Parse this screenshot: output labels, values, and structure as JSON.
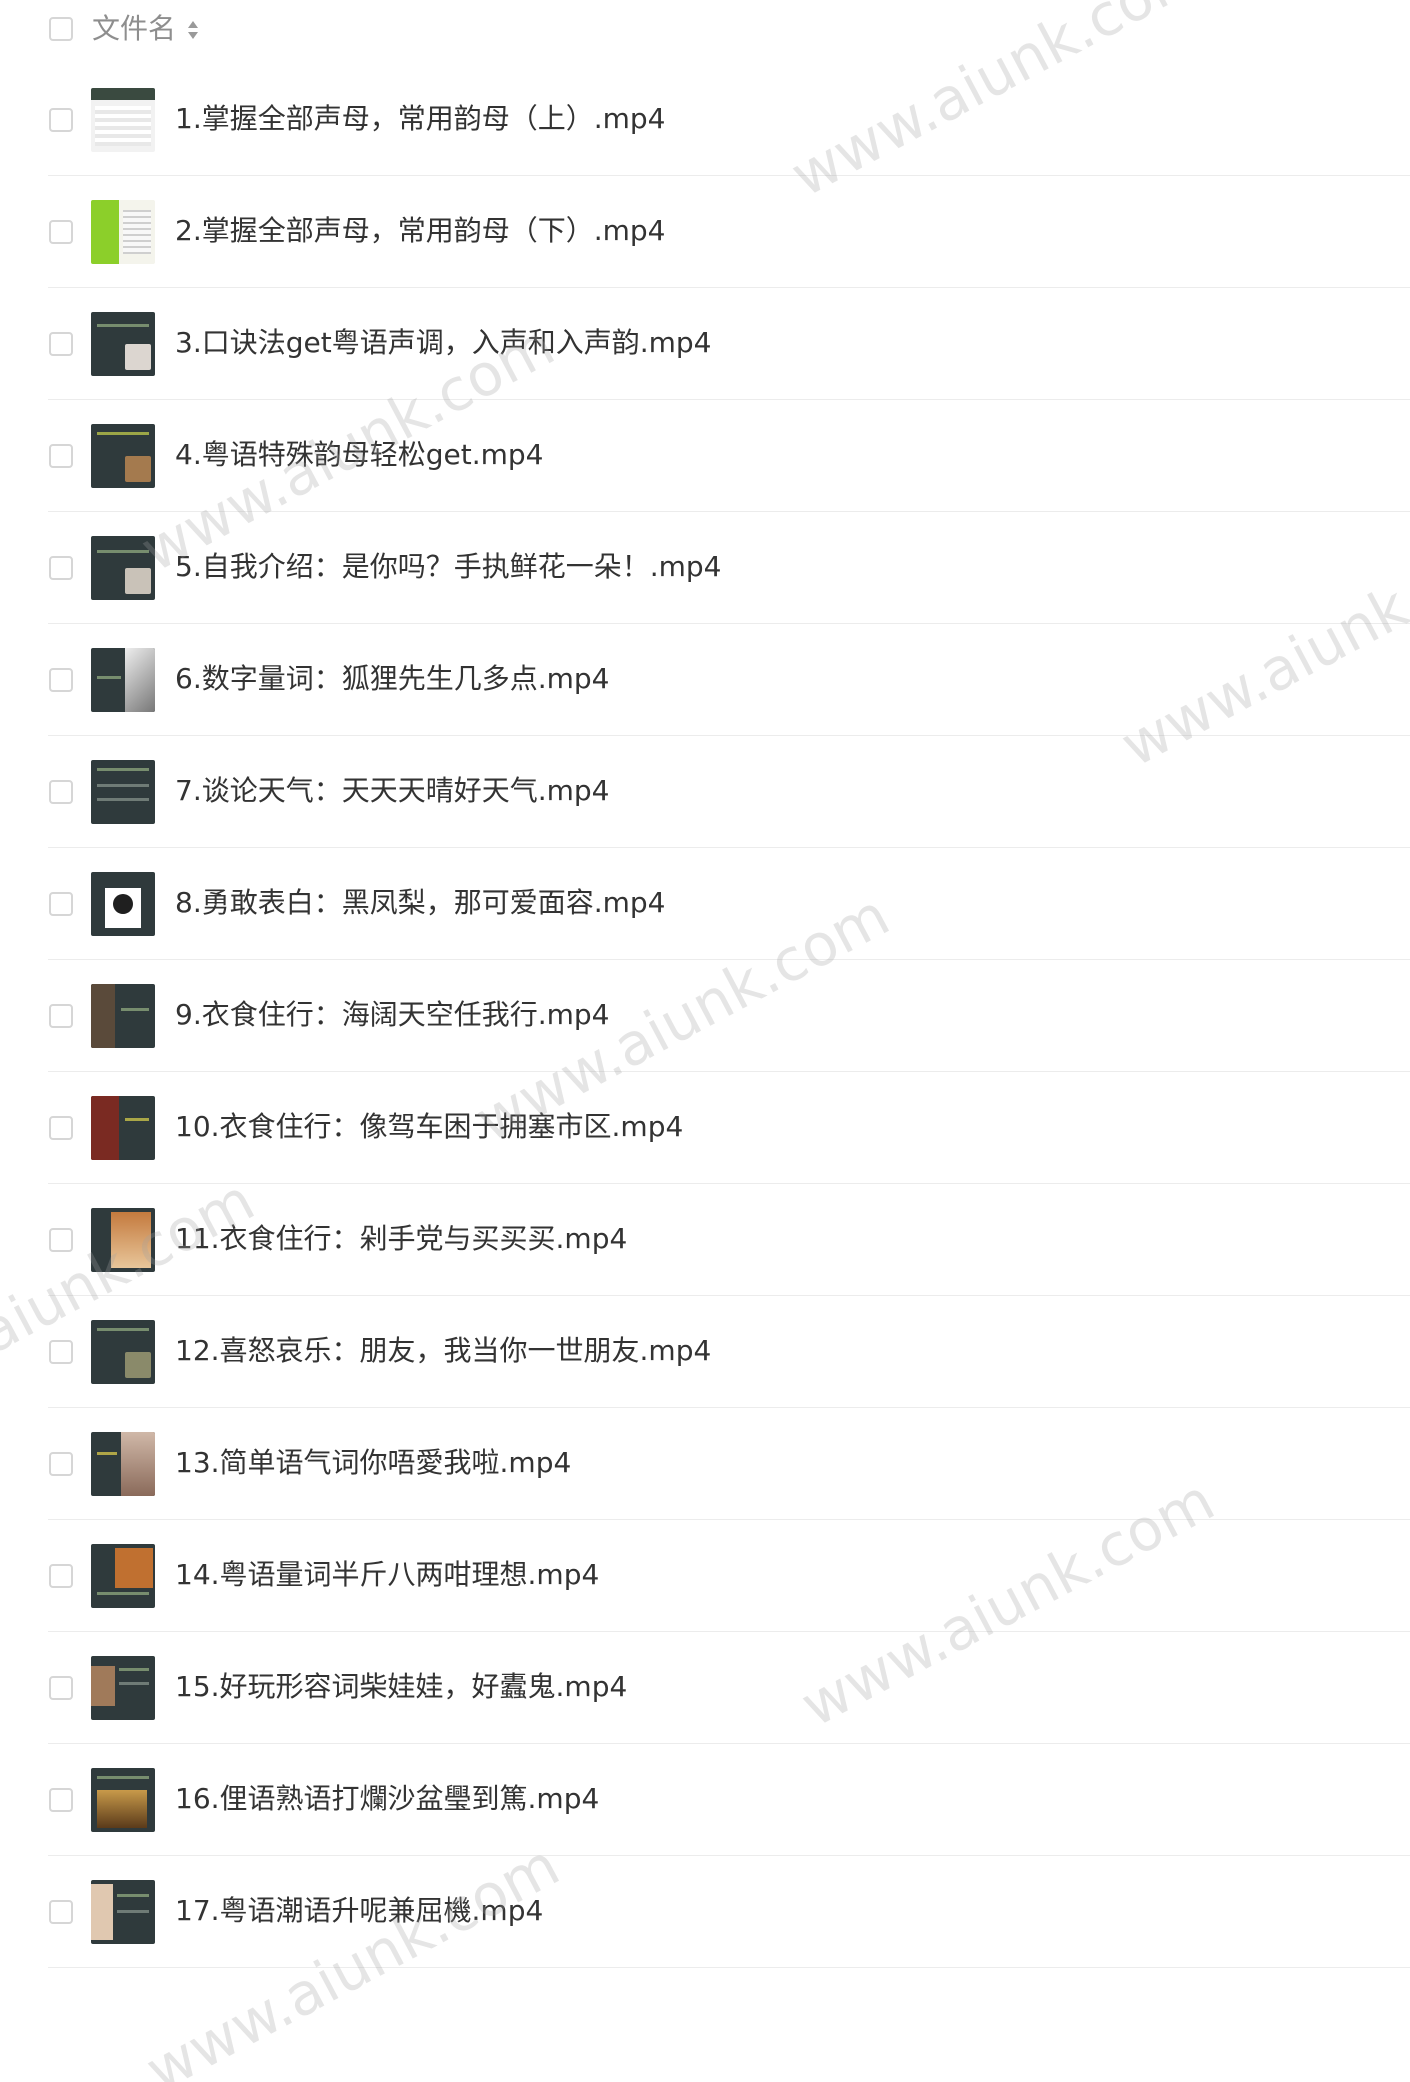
{
  "header": {
    "column_label": "文件名"
  },
  "icons": {
    "sort": "sort-icon",
    "checkbox": "checkbox-icon",
    "thumbnail": "video-thumbnail-icon"
  },
  "colors": {
    "text": "#333333",
    "header_text": "#8e8e8e",
    "divider": "#ececec",
    "checkbox_border": "#d6d6d6",
    "thumb_bg": "#2f3a3c",
    "watermark": "#a0a0a0"
  },
  "watermark_text": "www.aiunk.com",
  "files": [
    {
      "name": "1.掌握全部声母，常用韵母（上）.mp4"
    },
    {
      "name": "2.掌握全部声母，常用韵母（下）.mp4"
    },
    {
      "name": "3.口诀法get粤语声调，入声和入声韵.mp4"
    },
    {
      "name": "4.粤语特殊韵母轻松get.mp4"
    },
    {
      "name": "5.自我介绍：是你吗？手执鲜花一朵！.mp4"
    },
    {
      "name": "6.数字量词：狐狸先生几多点.mp4"
    },
    {
      "name": "7.谈论天气：天天天晴好天气.mp4"
    },
    {
      "name": "8.勇敢表白：黑凤梨，那可爱面容.mp4"
    },
    {
      "name": "9.衣食住行：海阔天空任我行.mp4"
    },
    {
      "name": "10.衣食住行：像驾车困于拥塞市区.mp4"
    },
    {
      "name": "11.衣食住行：剁手党与买买买.mp4"
    },
    {
      "name": "12.喜怒哀乐：朋友，我当你一世朋友.mp4"
    },
    {
      "name": "13.简单语气词你唔愛我啦.mp4"
    },
    {
      "name": "14.粤语量词半斤八两咁理想.mp4"
    },
    {
      "name": "15.好玩形容词柴娃娃，好蠹鬼.mp4"
    },
    {
      "name": "16.俚语熟语打爛沙盆璺到篤.mp4"
    },
    {
      "name": "17.粤语潮语升呢兼屈機.mp4"
    }
  ]
}
